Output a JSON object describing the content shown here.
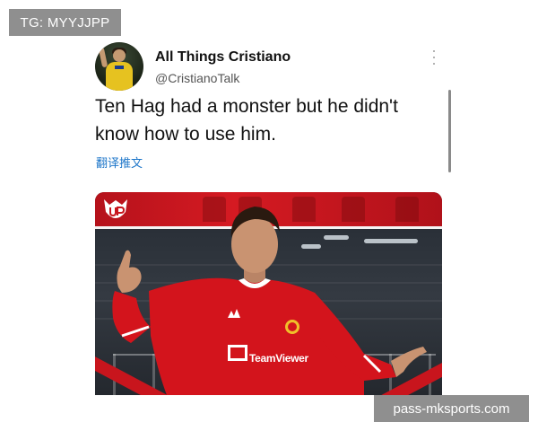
{
  "overlay": {
    "tg_label": "TG: MYYJJPP"
  },
  "tweet": {
    "display_name": "All Things Cristiano",
    "handle": "@CristianoTalk",
    "text": "Ten Hag had a monster but he didn't know how to use him.",
    "translate_link": "翻译推文",
    "more_icon": "more-vertical-icon"
  },
  "media": {
    "sponsor_text": "TeamViewer",
    "channel_logo": "UP TV"
  },
  "watermark": {
    "label": "pass-mksports.com"
  },
  "colors": {
    "accent_red": "#d51a22",
    "link_blue": "#1d76c9",
    "label_gray": "#8f8f8f"
  }
}
